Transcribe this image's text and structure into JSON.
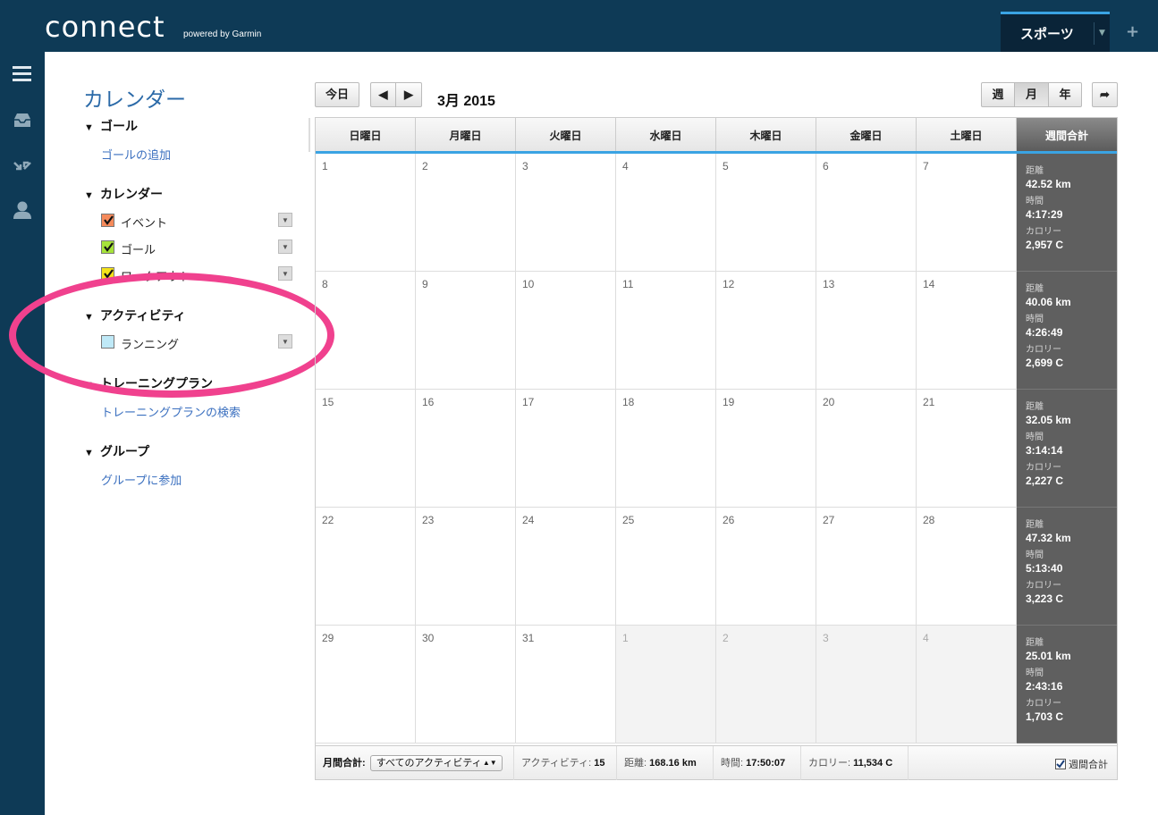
{
  "app": {
    "logo": "connect",
    "logo_sub": "powered by Garmin",
    "active_tab": "スポーツ",
    "add_tab": "+"
  },
  "rail": {
    "icons": [
      "menu-icon",
      "inbox-icon",
      "sync-icon",
      "user-icon"
    ]
  },
  "sidebar": {
    "title": "カレンダー",
    "goal_section": {
      "header": "ゴール",
      "link": "ゴールの追加"
    },
    "calendar_section": {
      "header": "カレンダー",
      "items": [
        {
          "label": "イベント",
          "color": "#f58a5b",
          "checked": true
        },
        {
          "label": "ゴール",
          "color": "#a6e33a",
          "checked": true
        },
        {
          "label": "ワークアウト",
          "color": "#f4e21a",
          "checked": true
        }
      ]
    },
    "activity_section": {
      "header": "アクティビティ",
      "items": [
        {
          "label": "ランニング",
          "color": "#bfe9f7",
          "checked": false
        }
      ]
    },
    "plan_section": {
      "header": "トレーニングプラン",
      "link": "トレーニングプランの検索"
    },
    "group_section": {
      "header": "グループ",
      "link": "グループに参加"
    }
  },
  "toolbar": {
    "today": "今日",
    "prev": "◀",
    "next": "▶",
    "month_title": "3月 2015",
    "view_week": "週",
    "view_month": "月",
    "view_year": "年",
    "share": "➦"
  },
  "calendar": {
    "headers": [
      "日曜日",
      "月曜日",
      "火曜日",
      "水曜日",
      "木曜日",
      "金曜日",
      "土曜日",
      "週間合計"
    ],
    "weeks": [
      {
        "days": [
          "1",
          "2",
          "3",
          "4",
          "5",
          "6",
          "7"
        ],
        "other": [
          false,
          false,
          false,
          false,
          false,
          false,
          false
        ],
        "summary": {
          "distance_label": "距離",
          "distance": "42.52 km",
          "time_label": "時間",
          "time": "4:17:29",
          "calories_label": "カロリー",
          "calories": "2,957 C"
        }
      },
      {
        "days": [
          "8",
          "9",
          "10",
          "11",
          "12",
          "13",
          "14"
        ],
        "other": [
          false,
          false,
          false,
          false,
          false,
          false,
          false
        ],
        "summary": {
          "distance_label": "距離",
          "distance": "40.06 km",
          "time_label": "時間",
          "time": "4:26:49",
          "calories_label": "カロリー",
          "calories": "2,699 C"
        }
      },
      {
        "days": [
          "15",
          "16",
          "17",
          "18",
          "19",
          "20",
          "21"
        ],
        "other": [
          false,
          false,
          false,
          false,
          false,
          false,
          false
        ],
        "summary": {
          "distance_label": "距離",
          "distance": "32.05 km",
          "time_label": "時間",
          "time": "3:14:14",
          "calories_label": "カロリー",
          "calories": "2,227 C"
        }
      },
      {
        "days": [
          "22",
          "23",
          "24",
          "25",
          "26",
          "27",
          "28"
        ],
        "other": [
          false,
          false,
          false,
          false,
          false,
          false,
          false
        ],
        "summary": {
          "distance_label": "距離",
          "distance": "47.32 km",
          "time_label": "時間",
          "time": "5:13:40",
          "calories_label": "カロリー",
          "calories": "3,223 C"
        }
      },
      {
        "days": [
          "29",
          "30",
          "31",
          "1",
          "2",
          "3",
          "4"
        ],
        "other": [
          false,
          false,
          false,
          true,
          true,
          true,
          true
        ],
        "summary": {
          "distance_label": "距離",
          "distance": "25.01 km",
          "time_label": "時間",
          "time": "2:43:16",
          "calories_label": "カロリー",
          "calories": "1,703 C"
        }
      }
    ]
  },
  "footer": {
    "month_total_label": "月間合計:",
    "filter_value": "すべてのアクティビティ",
    "activities_label": "アクティビティ:",
    "activities_value": "15",
    "distance_label": "距離:",
    "distance_value": "168.16 km",
    "time_label": "時間:",
    "time_value": "17:50:07",
    "calories_label": "カロリー:",
    "calories_value": "11,534 C",
    "weekly_total_label": "週間合計",
    "weekly_total_checked": true
  },
  "colors": {
    "header_bg": "#0e3a56",
    "accent": "#3aa3e3",
    "link": "#3a6fbf",
    "summary_bg": "#5f5f5f",
    "highlight_ellipse": "#f0418e"
  }
}
